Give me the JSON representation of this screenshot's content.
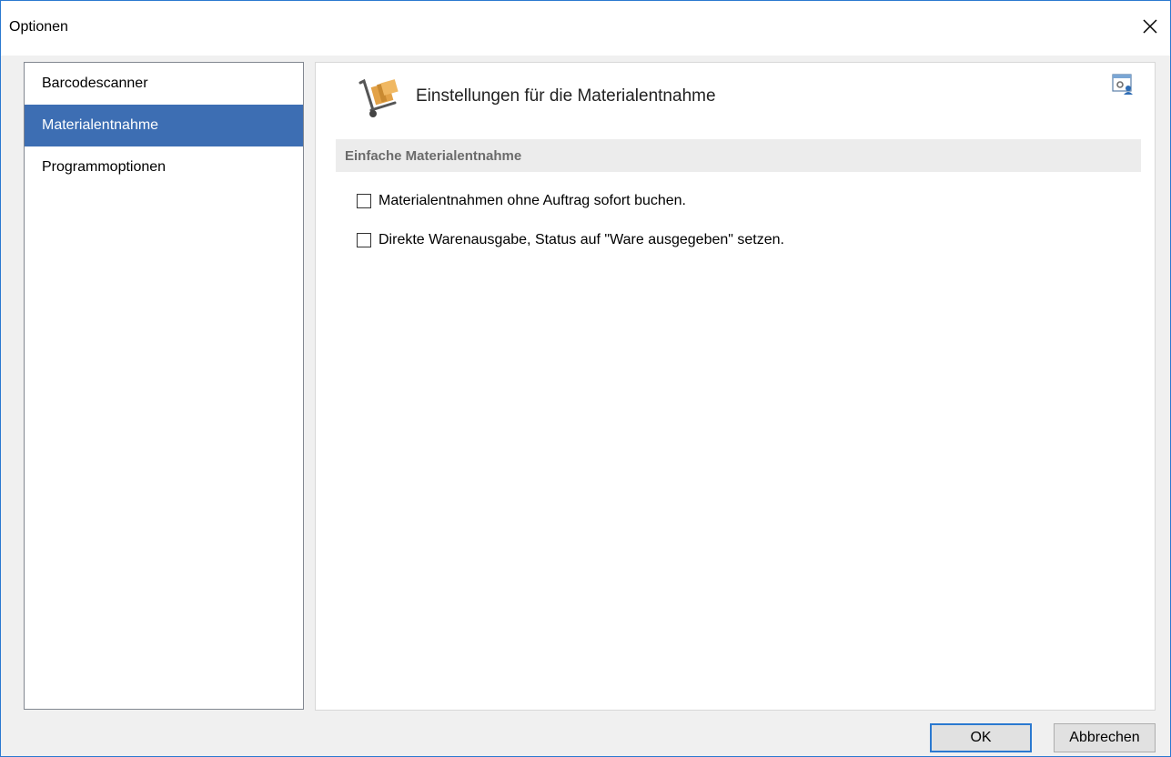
{
  "window": {
    "title": "Optionen"
  },
  "sidebar": {
    "items": [
      {
        "label": "Barcodescanner",
        "selected": false
      },
      {
        "label": "Materialentnahme",
        "selected": true
      },
      {
        "label": "Programmoptionen",
        "selected": false
      }
    ]
  },
  "main": {
    "header_title": "Einstellungen für die Materialentnahme",
    "header_icon": "hand-truck-box-icon",
    "settings_icon": "window-settings-icon",
    "section_title": "Einfache Materialentnahme",
    "options": [
      {
        "label": "Materialentnahmen ohne Auftrag sofort buchen.",
        "checked": false
      },
      {
        "label": "Direkte Warenausgabe, Status auf \"Ware ausgegeben\" setzen.",
        "checked": false
      }
    ]
  },
  "buttons": {
    "ok_label": "OK",
    "cancel_label": "Abbrechen"
  },
  "colors": {
    "selection": "#3d6eb3",
    "accent": "#2b79d0",
    "section_bg": "#ececec"
  }
}
